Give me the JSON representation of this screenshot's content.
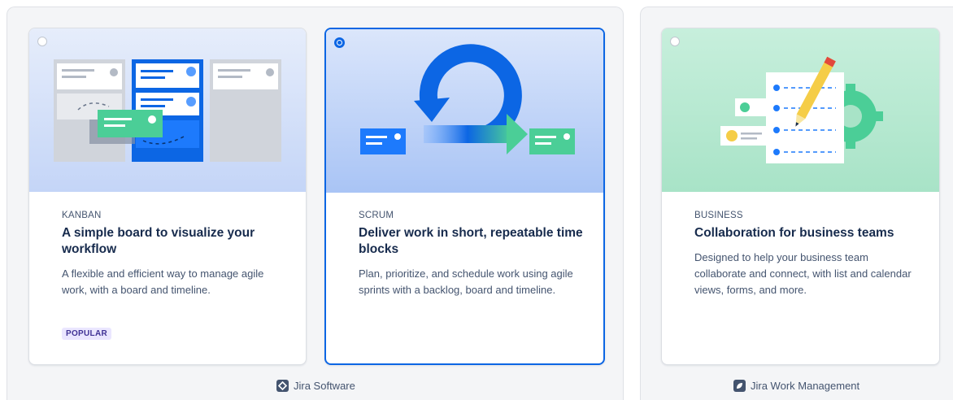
{
  "groups": {
    "software": {
      "product_label": "Jira Software",
      "product_icon": "jira-software-icon"
    },
    "business": {
      "product_label": "Jira Work Management",
      "product_icon": "jira-work-management-icon"
    }
  },
  "cards": [
    {
      "kicker": "KANBAN",
      "title": "A simple board to visualize your workflow",
      "description": "A flexible and efficient way to manage agile work, with a board and timeline.",
      "badge": "POPULAR",
      "selected": false
    },
    {
      "kicker": "SCRUM",
      "title": "Deliver work in short, repeatable time blocks",
      "description": "Plan, prioritize, and schedule work using agile sprints with a backlog, board and timeline.",
      "selected": true
    },
    {
      "kicker": "BUSINESS",
      "title": "Collaboration for business teams",
      "description": "Designed to help your business team collaborate and connect, with list and calendar views, forms, and more.",
      "selected": false
    }
  ],
  "colors": {
    "selected_border": "#0c66e4",
    "software_illustration_bg": "#dbe6fb",
    "business_illustration_bg": "#c7efdc",
    "popular_badge_bg": "#eae6ff",
    "popular_badge_text": "#403294"
  }
}
